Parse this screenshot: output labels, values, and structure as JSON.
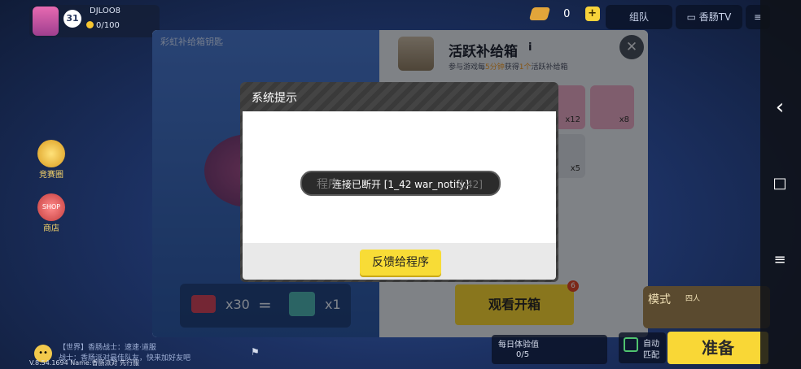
{
  "player": {
    "name": "DJLOO8",
    "level": "31",
    "coins": "0/100"
  },
  "currency": {
    "amount": "0",
    "add_label": "+"
  },
  "top_buttons": {
    "team": "组队",
    "tv": "香肠TV"
  },
  "side": {
    "competition": "竞赛圈",
    "shop_badge": "SHOP",
    "shop": "商店"
  },
  "panel": {
    "left_title": "彩虹补给箱钥匙",
    "cost": {
      "key_count": "x30",
      "equals": "=",
      "box_count": "x1"
    },
    "title": "活跃补给箱",
    "info": "i",
    "subtitle_pre": "参与游戏每",
    "subtitle_time": "5分钟",
    "subtitle_mid": "获得",
    "subtitle_num": "1个",
    "subtitle_post": "活跃补给箱",
    "rewards": [
      "x12",
      "x8",
      "x5"
    ],
    "close": "✕",
    "watch_label": "观看开箱",
    "watch_badge": "6"
  },
  "dialog": {
    "title": "系统提示",
    "toast": "连接已断开 [1_42 war_notify]",
    "ghost_left": "程序",
    "ghost_right": "d:42]",
    "button": "反馈给程序"
  },
  "bottom": {
    "mode_label": "模式",
    "mode_sub": "四人",
    "auto_label": "自动",
    "auto_sub": "匹配",
    "ready": "准备",
    "daily": "每日体验值",
    "daily_progress": "0/5",
    "chat_line1": "【世界】香肠战士：速速·道服",
    "chat_line2": "战士：香肠派对最佳队友，快来加好友吧",
    "version": "V.8.54.1694 Name:香肠派对 先行服"
  },
  "nav": {
    "back": "‹",
    "home": "□",
    "menu": "≡"
  },
  "colors": {
    "accent": "#f9d736",
    "panel": "#e8edf4",
    "dialog_header": "#3b3b3b"
  }
}
